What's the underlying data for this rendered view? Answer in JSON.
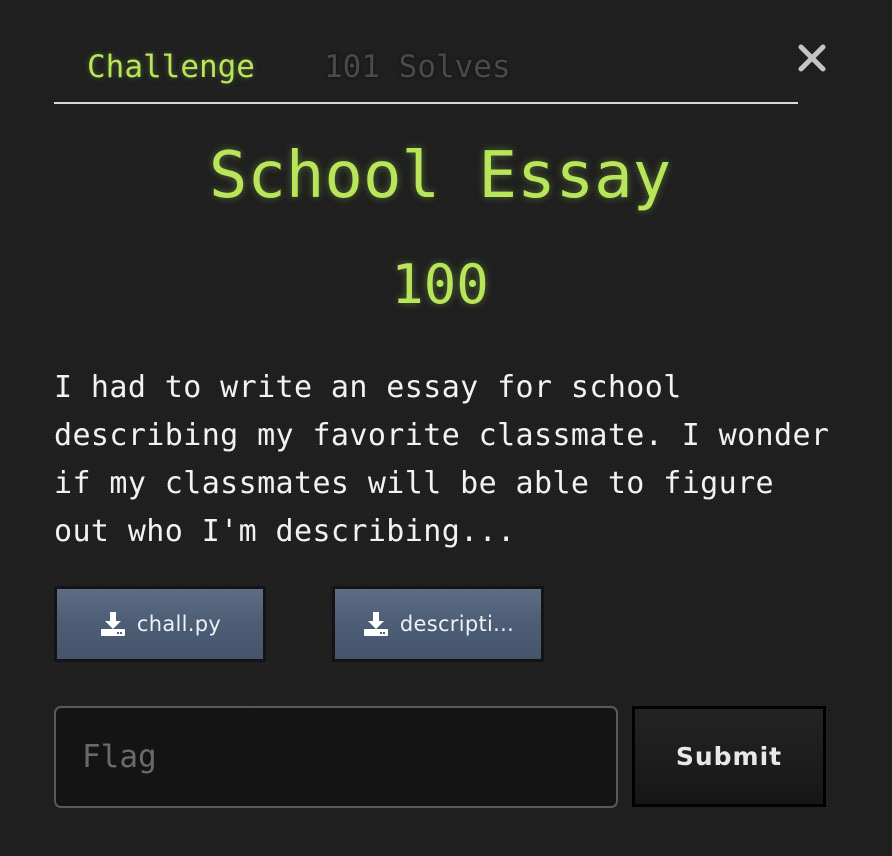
{
  "tabs": {
    "challenge_label": "Challenge",
    "solves_label": "101 Solves"
  },
  "close": {
    "icon": "close-icon"
  },
  "challenge": {
    "title": "School Essay",
    "points": "100",
    "description": "I had to write an essay for school describing my favorite classmate. I wonder if my classmates will be able to figure out who I'm describing..."
  },
  "files": [
    {
      "label": "chall.py",
      "icon": "download-icon"
    },
    {
      "label": "descripti...",
      "icon": "download-icon"
    }
  ],
  "flag_form": {
    "placeholder": "Flag",
    "value": "",
    "submit_label": "Submit"
  },
  "colors": {
    "accent": "#b8e55a",
    "background": "#1f1f1f",
    "file_button": "#4d5e76"
  }
}
